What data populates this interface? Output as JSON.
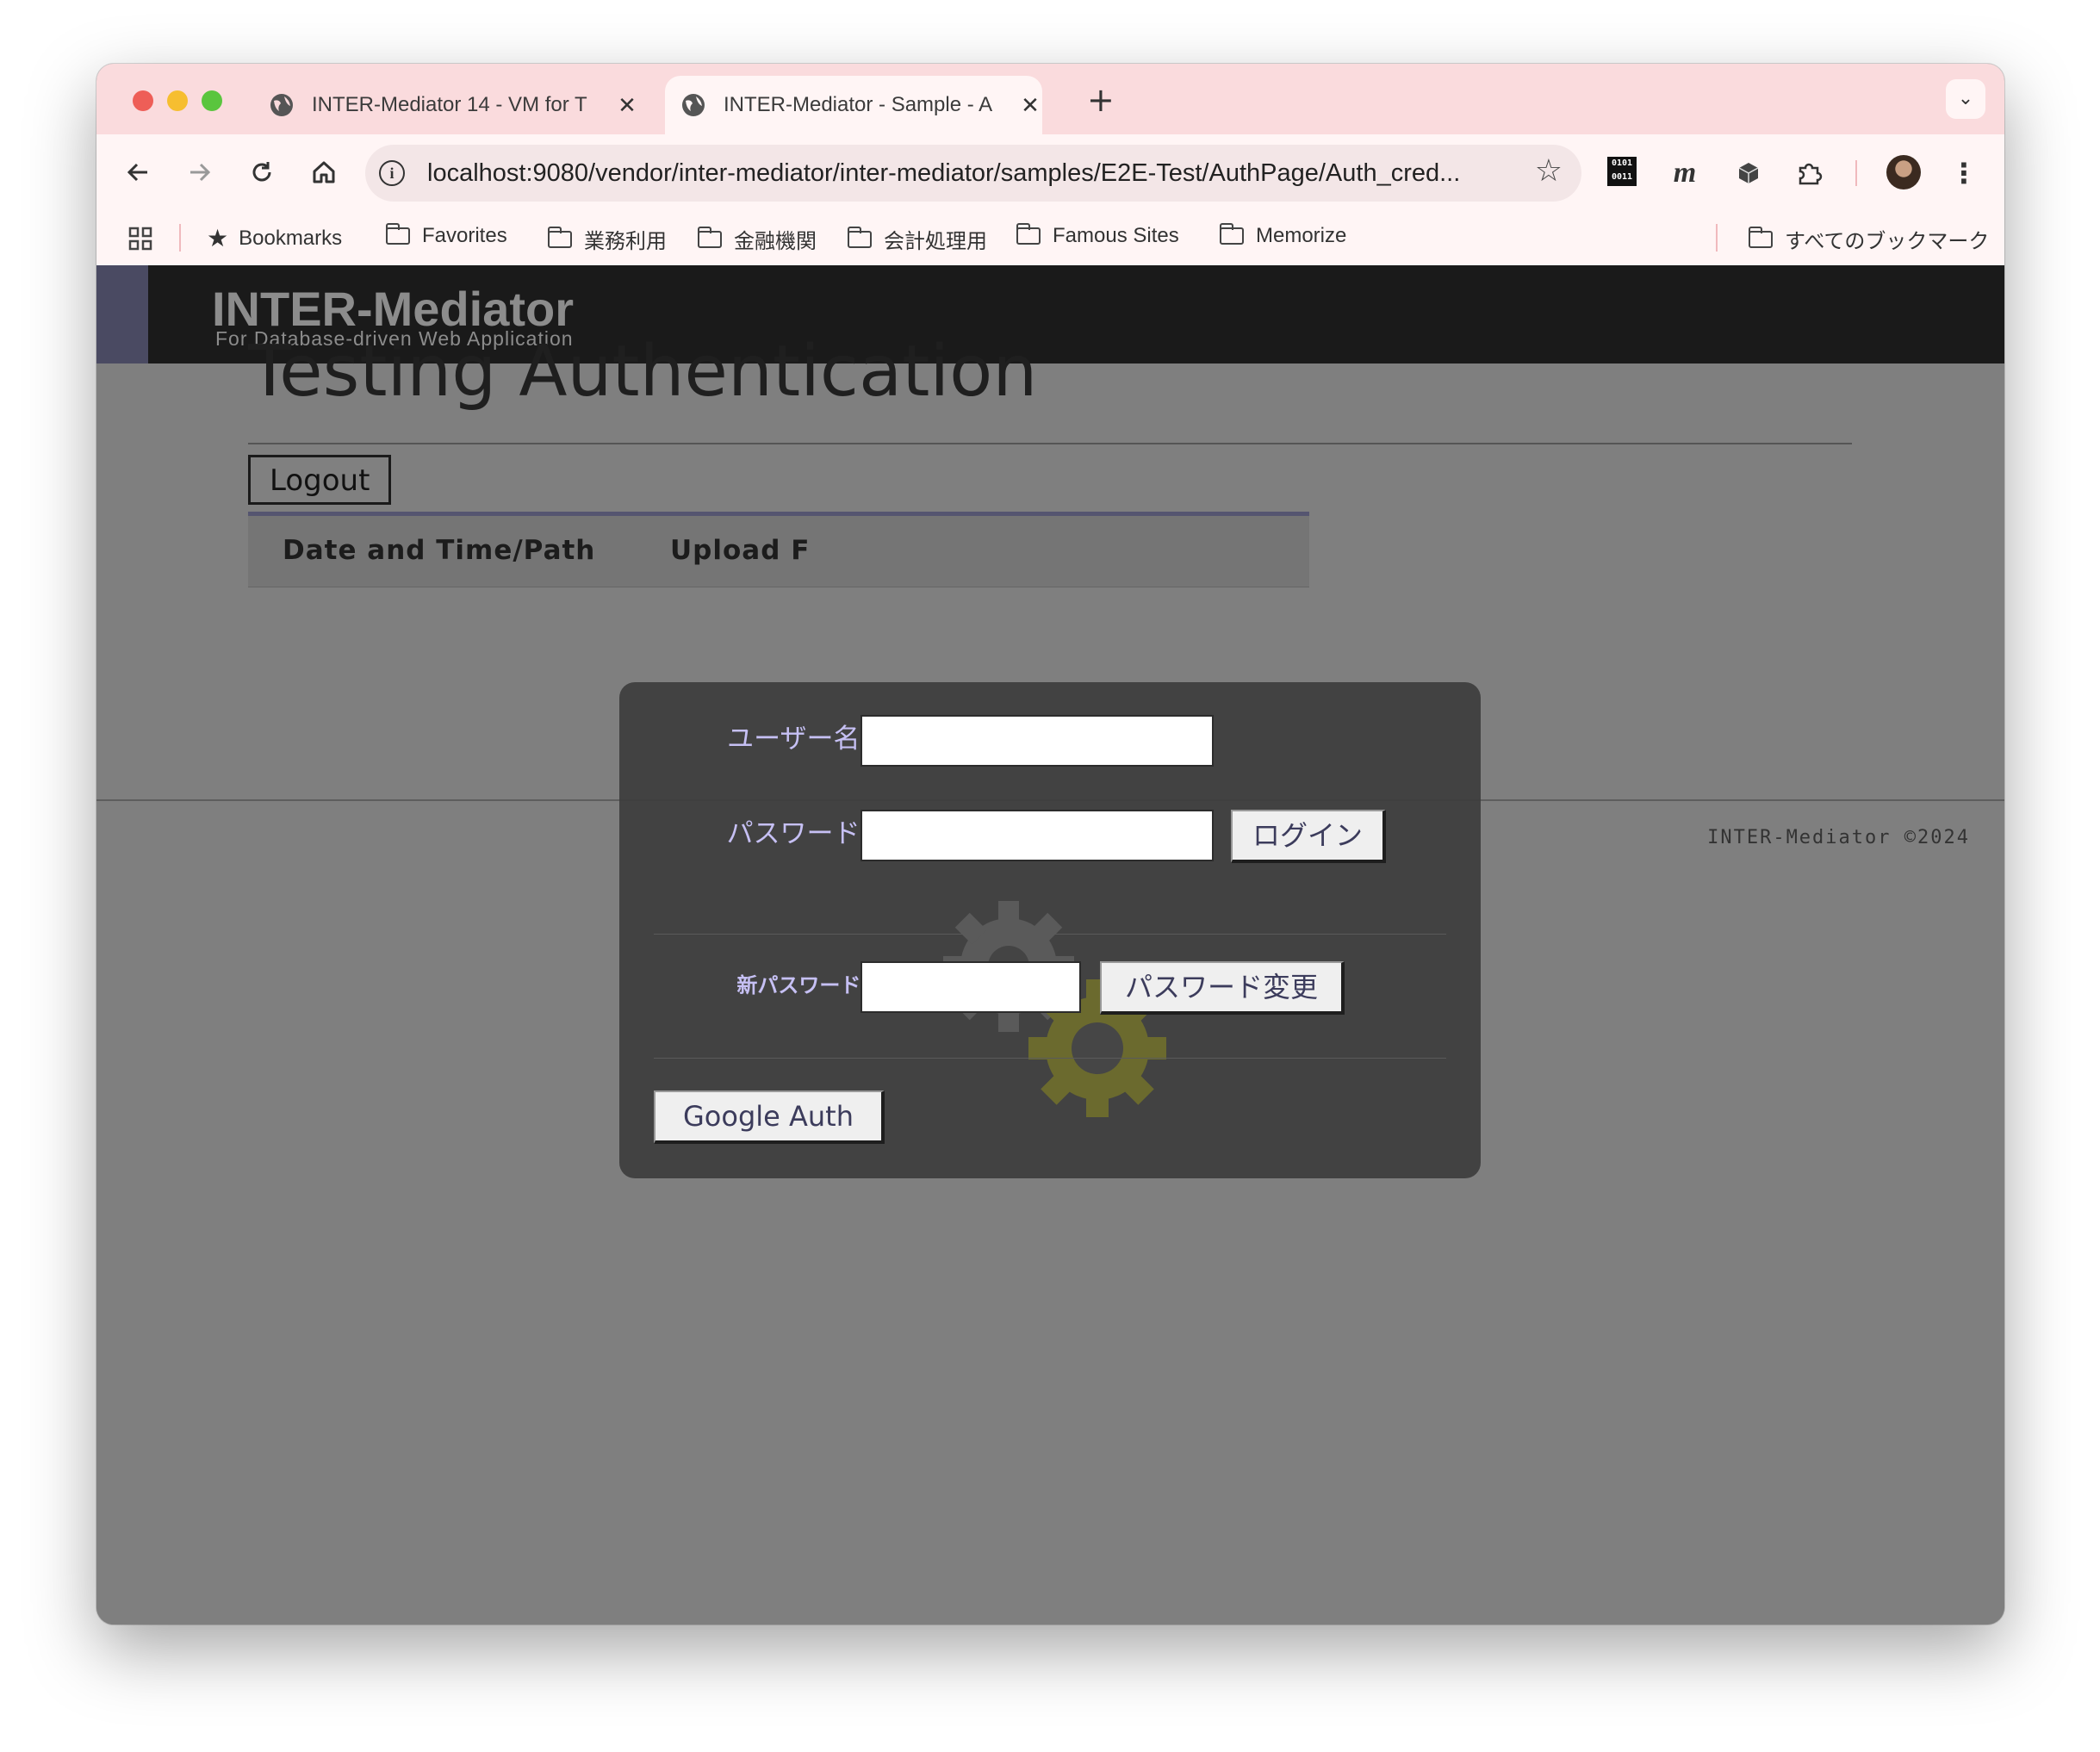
{
  "browser": {
    "tabs": [
      {
        "title": "INTER-Mediator 14 - VM for T",
        "close": "✕"
      },
      {
        "title": "INTER-Mediator - Sample - A",
        "close": "✕"
      }
    ],
    "new_tab": "+",
    "tab_list": "⌄",
    "url": "localhost:9080/vendor/inter-mediator/inter-mediator/samples/E2E-Test/AuthPage/Auth_cred...",
    "bookmarks": [
      "Bookmarks",
      "Favorites",
      "業務利用",
      "金融機関",
      "会計処理用",
      "Famous Sites",
      "Memorize"
    ],
    "all_bookmarks": "すべてのブックマーク",
    "extension_binary": "0101\n0011",
    "extension_m": "m",
    "icons": [
      "back-icon",
      "forward-icon",
      "reload-icon",
      "home-icon",
      "info-icon",
      "star-icon",
      "puzzle-icon",
      "more-icon",
      "apps-icon",
      "folder-icon"
    ]
  },
  "page": {
    "logo_main": "INTER-Mediator",
    "logo_sub": "For Database-driven Web Application",
    "title": "Testing Authentication",
    "logout": "Logout",
    "tabs": [
      "Date and Time/Path",
      "Upload F"
    ],
    "footer": "INTER-Mediator ©2024"
  },
  "auth": {
    "username_label": "ユーザー名:",
    "username_value": "",
    "password_label": "パスワード:",
    "password_value": "",
    "login_button": "ログイン",
    "new_password_label": "新パスワード:",
    "new_password_value": "",
    "change_password_button": "パスワード変更",
    "google_auth_button": "Google Auth"
  },
  "colors": {
    "tabstrip": "#fadbdd",
    "toolbar": "#fff5f5",
    "page_bg": "#7f7f7f",
    "header_bg": "#1a1a1a",
    "dialog_bg": "#3c3c3c",
    "dialog_label": "#c6c0f4"
  }
}
